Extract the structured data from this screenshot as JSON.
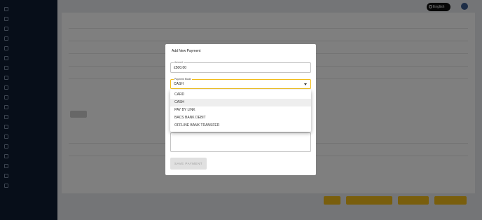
{
  "header": {
    "language_label": "English"
  },
  "modal": {
    "title": "Add New Payment",
    "amount": {
      "label": "Amount",
      "value": "£500.00"
    },
    "payment_mode": {
      "label": "Payment Mode",
      "value": "CASH",
      "options": [
        "CARD",
        "CASH",
        "PAY BY LINK",
        "BACS BANK DEBIT",
        "OFFLINE BANK TRANSFER"
      ],
      "selected_index": 1
    },
    "save_label": "SAVE PAYMENT"
  },
  "colors": {
    "accent": "#f2bd1a",
    "sidebar": "#0e1d33",
    "overlay": "rgba(0,0,0,0.5)"
  }
}
